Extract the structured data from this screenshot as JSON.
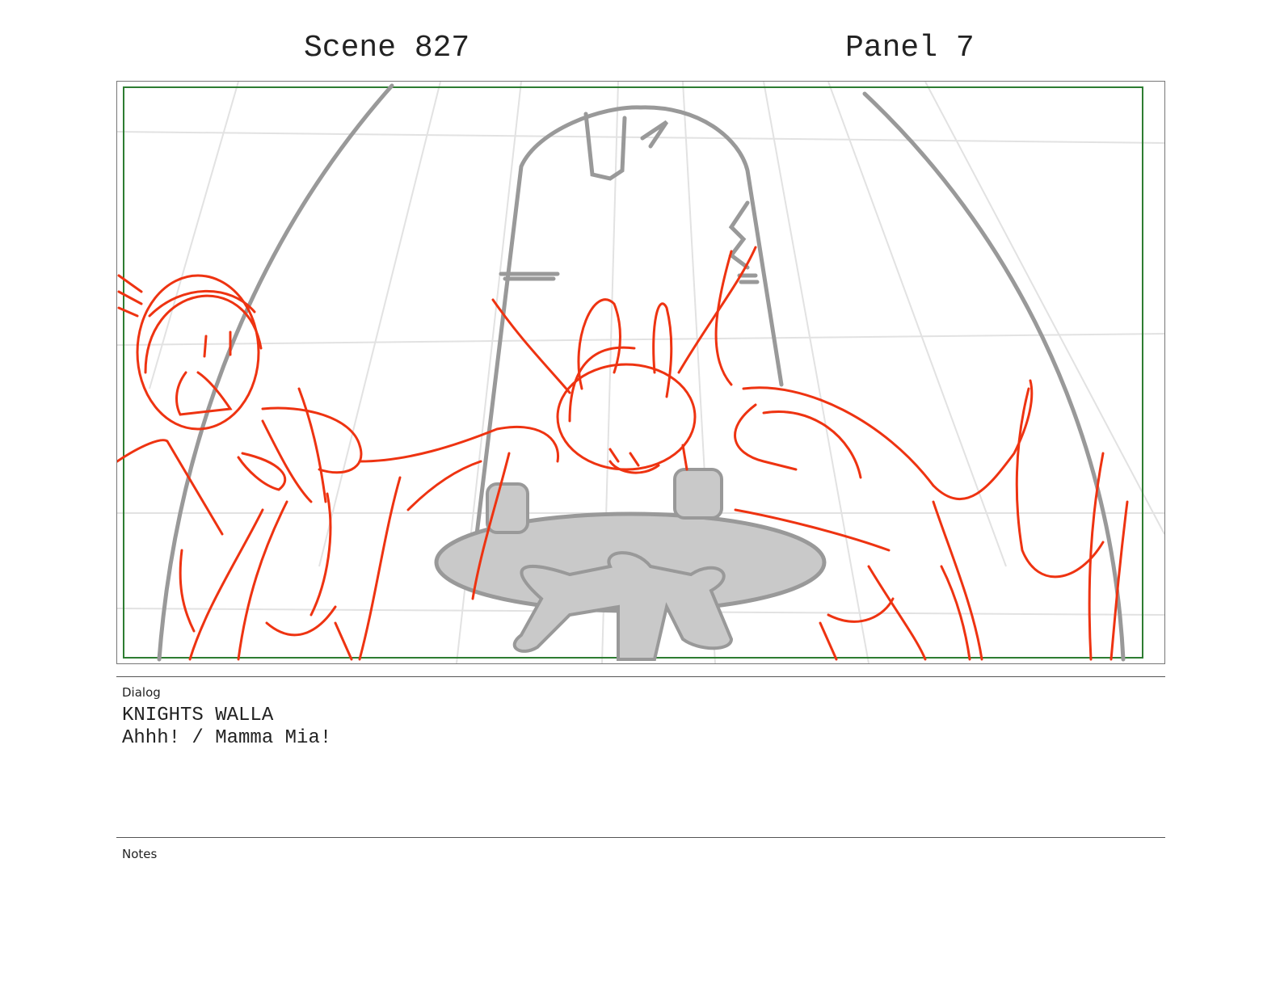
{
  "header": {
    "scene": "Scene 827",
    "panel": "Panel 7"
  },
  "dialog": {
    "heading": "Dialog",
    "speaker": "KNIGHTS WALLA",
    "line": "Ahhh! / Mamma Mia!"
  },
  "notes": {
    "heading": "Notes"
  },
  "colors": {
    "sketch_red": "#ee3311",
    "sketch_grey": "#999999",
    "safe_frame_green": "#2e7d32"
  }
}
